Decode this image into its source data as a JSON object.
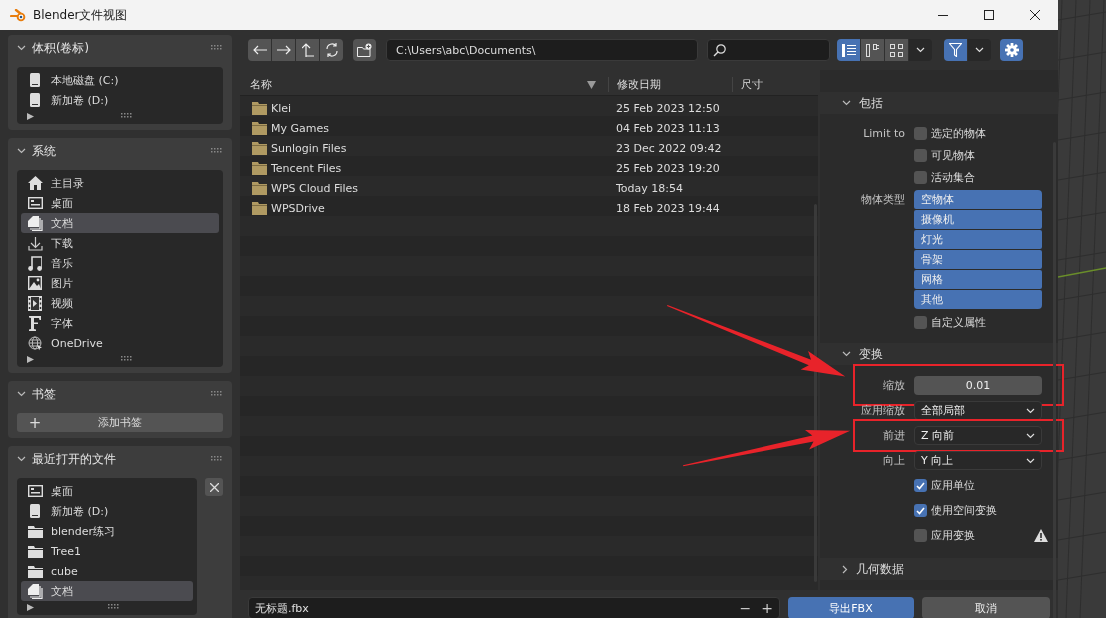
{
  "window": {
    "title": "Blender文件视图"
  },
  "sidebar": {
    "panels": [
      {
        "title": "体积(卷标)",
        "kind": "list",
        "items": [
          {
            "label": "本地磁盘 (C:)",
            "kind": "drive",
            "selected": false
          },
          {
            "label": "新加卷 (D:)",
            "kind": "drive",
            "selected": false
          }
        ]
      },
      {
        "title": "系统",
        "kind": "list",
        "items": [
          {
            "label": "主目录",
            "kind": "home",
            "selected": false
          },
          {
            "label": "桌面",
            "kind": "desktop",
            "selected": false
          },
          {
            "label": "文档",
            "kind": "documents",
            "selected": true
          },
          {
            "label": "下载",
            "kind": "download",
            "selected": false
          },
          {
            "label": "音乐",
            "kind": "music",
            "selected": false
          },
          {
            "label": "图片",
            "kind": "image",
            "selected": false
          },
          {
            "label": "视频",
            "kind": "video",
            "selected": false
          },
          {
            "label": "字体",
            "kind": "font",
            "selected": false
          },
          {
            "label": "OneDrive",
            "kind": "network",
            "selected": false
          }
        ]
      },
      {
        "title": "书签",
        "kind": "button",
        "button_icon": "+",
        "button": "添加书签"
      },
      {
        "title": "最近打开的文件",
        "kind": "list",
        "clearable": true,
        "items": [
          {
            "label": "桌面",
            "kind": "desktop",
            "selected": false
          },
          {
            "label": "新加卷 (D:)",
            "kind": "drive",
            "selected": false
          },
          {
            "label": "blender练习",
            "kind": "folder",
            "selected": false
          },
          {
            "label": "Tree1",
            "kind": "folder",
            "selected": false
          },
          {
            "label": "cube",
            "kind": "folder",
            "selected": false
          },
          {
            "label": "文档",
            "kind": "documents",
            "selected": true
          }
        ]
      }
    ]
  },
  "toolbar": {
    "path": "C:\\Users\\abc\\Documents\\",
    "view_modes": [
      {
        "selected": true
      },
      {
        "selected": false
      },
      {
        "selected": false
      }
    ],
    "filter_on": true
  },
  "file_list": {
    "columns": [
      "名称",
      "修改日期",
      "尺寸"
    ],
    "rows": [
      {
        "name": "Klei",
        "date": "25 Feb 2023 12:50"
      },
      {
        "name": "My Games",
        "date": "04 Feb 2023 11:13"
      },
      {
        "name": "Sunlogin Files",
        "date": "23 Dec 2022 09:42"
      },
      {
        "name": "Tencent Files",
        "date": "25 Feb 2023 19:20"
      },
      {
        "name": "WPS Cloud Files",
        "date": "Today 18:54"
      },
      {
        "name": "WPSDrive",
        "date": "18 Feb 2023 19:44"
      }
    ]
  },
  "settings": {
    "sections": [
      {
        "title": "包括",
        "expanded": true,
        "rows": [
          {
            "kind": "checkbox",
            "label": "Limit to",
            "text": "选定的物体",
            "checked": false
          },
          {
            "kind": "checkbox",
            "text": "可见物体",
            "checked": false
          },
          {
            "kind": "checkbox",
            "text": "活动集合",
            "checked": false
          },
          {
            "kind": "toggles",
            "label": "物体类型",
            "items": [
              {
                "text": "空物体",
                "selected": true
              },
              {
                "text": "摄像机",
                "selected": true
              },
              {
                "text": "灯光",
                "selected": true
              },
              {
                "text": "骨架",
                "selected": true
              },
              {
                "text": "网格",
                "selected": true
              },
              {
                "text": "其他",
                "selected": true
              }
            ]
          },
          {
            "kind": "checkbox",
            "text": "自定义属性",
            "checked": false
          }
        ]
      },
      {
        "title": "变换",
        "expanded": true,
        "rows": [
          {
            "kind": "number",
            "label": "缩放",
            "value": "0.01",
            "annotated": true
          },
          {
            "kind": "dropdown",
            "label": "应用缩放",
            "value": "全部局部",
            "annotated": false
          },
          {
            "kind": "dropdown",
            "label": "前进",
            "value": "Z 向前",
            "annotated": true
          },
          {
            "kind": "dropdown",
            "label": "向上",
            "value": "Y 向上",
            "annotated": false
          },
          {
            "kind": "checkbox",
            "text": "应用单位",
            "checked": true
          },
          {
            "kind": "checkbox",
            "text": "使用空间变换",
            "checked": true
          },
          {
            "kind": "checkbox",
            "text": "应用变换",
            "checked": false,
            "warning": true
          }
        ]
      },
      {
        "title": "几何数据",
        "expanded": false
      }
    ]
  },
  "footer": {
    "filename": "无标题.fbx",
    "decrement": "−",
    "increment": "+",
    "export_button": "导出FBX",
    "cancel_button": "取消"
  }
}
